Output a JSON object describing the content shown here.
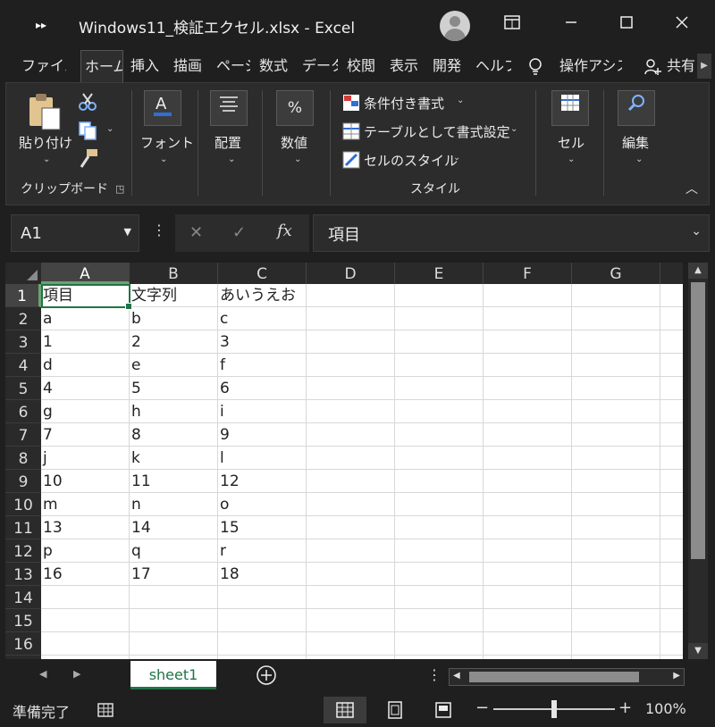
{
  "titlebar": {
    "title": "Windows11_検証エクセル.xlsx  -  Excel",
    "qat_icon": "chevrons-icon",
    "buttons": [
      "ribbon-display-icon",
      "minimize-icon",
      "maximize-icon",
      "close-icon"
    ]
  },
  "tabs": [
    {
      "label": "ファイル",
      "active": false
    },
    {
      "label": "ホーム",
      "active": true
    },
    {
      "label": "挿入",
      "active": false
    },
    {
      "label": "描画",
      "active": false
    },
    {
      "label": "ページ",
      "active": false
    },
    {
      "label": "数式",
      "active": false
    },
    {
      "label": "データ",
      "active": false
    },
    {
      "label": "校閲",
      "active": false
    },
    {
      "label": "表示",
      "active": false
    },
    {
      "label": "開発",
      "active": false
    },
    {
      "label": "ヘルプ",
      "active": false
    }
  ],
  "tellme": {
    "label": "操作アシス"
  },
  "share": {
    "label": "共有"
  },
  "ribbon": {
    "clipboard": {
      "paste_label": "貼り付け",
      "group_label": "クリップボード"
    },
    "font": {
      "label": "フォント"
    },
    "alignment": {
      "label": "配置"
    },
    "number": {
      "label": "数値"
    },
    "styles": {
      "conditional": "条件付き書式",
      "table": "テーブルとして書式設定",
      "cellstyles": "セルのスタイル",
      "group_label": "スタイル"
    },
    "cells": {
      "label": "セル"
    },
    "editing": {
      "label": "編集"
    }
  },
  "formula_bar": {
    "name_box": "A1",
    "formula": "項目",
    "fx": "fx"
  },
  "sheet": {
    "columns": [
      "A",
      "B",
      "C",
      "D",
      "E",
      "F",
      "G"
    ],
    "rows": [
      "1",
      "2",
      "3",
      "4",
      "5",
      "6",
      "7",
      "8",
      "9",
      "10",
      "11",
      "12",
      "13",
      "14",
      "15",
      "16"
    ],
    "cells": [
      [
        "項目",
        "文字列",
        "あいうえお"
      ],
      [
        "a",
        "b",
        "c"
      ],
      [
        "1",
        "2",
        "3"
      ],
      [
        "d",
        "e",
        "f"
      ],
      [
        "4",
        "5",
        "6"
      ],
      [
        "g",
        "h",
        "i"
      ],
      [
        "7",
        "8",
        "9"
      ],
      [
        "j",
        "k",
        "l"
      ],
      [
        "10",
        "11",
        "12"
      ],
      [
        "m",
        "n",
        "o"
      ],
      [
        "13",
        "14",
        "15"
      ],
      [
        "p",
        "q",
        "r"
      ],
      [
        "16",
        "17",
        "18"
      ]
    ],
    "selected": "A1"
  },
  "sheet_tabs": {
    "active": "sheet1"
  },
  "status": {
    "ready": "準備完了",
    "zoom": "100%",
    "zoom_level_percent": 100
  },
  "colors": {
    "accent": "#217346",
    "bg": "#1f1f1f"
  }
}
